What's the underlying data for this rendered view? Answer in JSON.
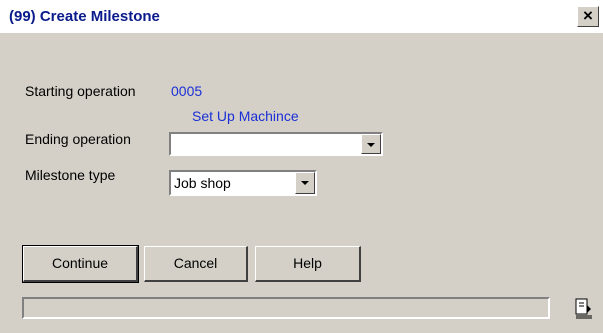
{
  "window": {
    "title": "(99) Create Milestone",
    "close_glyph": "×"
  },
  "form": {
    "starting_operation_label": "Starting operation",
    "starting_operation_number": "0005",
    "starting_operation_desc": "Set Up Machince",
    "ending_operation_label": "Ending operation",
    "ending_operation_value": "",
    "milestone_type_label": "Milestone type",
    "milestone_type_value": "Job shop"
  },
  "buttons": {
    "continue": "Continue",
    "cancel": "Cancel",
    "help": "Help"
  },
  "status": {
    "text": "",
    "icon": "window-copy-icon"
  },
  "colors": {
    "title_text": "#0a1b8c",
    "value_blue": "#1a2fd6",
    "face": "#d4d0c8"
  }
}
